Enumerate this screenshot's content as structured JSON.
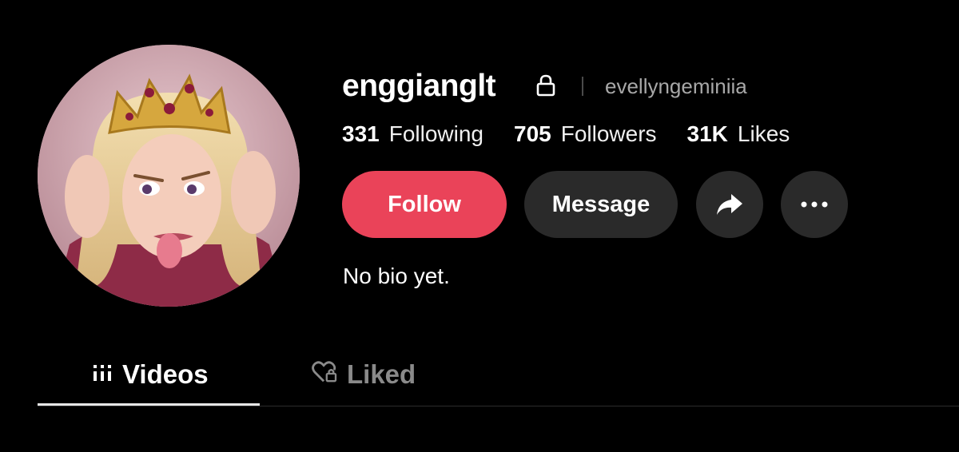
{
  "profile": {
    "username": "enggianglt",
    "nickname": "evellyngeminiia",
    "bio": "No bio yet.",
    "avatar_icon": "profile-avatar-image",
    "lock_icon": "lock-icon"
  },
  "stats": [
    {
      "value": "331",
      "label": "Following"
    },
    {
      "value": "705",
      "label": "Followers"
    },
    {
      "value": "31K",
      "label": "Likes"
    }
  ],
  "actions": {
    "follow_label": "Follow",
    "message_label": "Message",
    "share_icon": "share-arrow-icon",
    "more_icon": "more-dots-icon"
  },
  "tabs": [
    {
      "label": "Videos",
      "icon": "grid-lines-icon",
      "active": true
    },
    {
      "label": "Liked",
      "icon": "heart-lock-icon",
      "active": false
    }
  ],
  "colors": {
    "background": "#000000",
    "follow_button": "#ea4359",
    "secondary_button": "#2a2a2a",
    "muted_text": "#a8a8a8",
    "inactive_tab": "#8a8a8a"
  }
}
